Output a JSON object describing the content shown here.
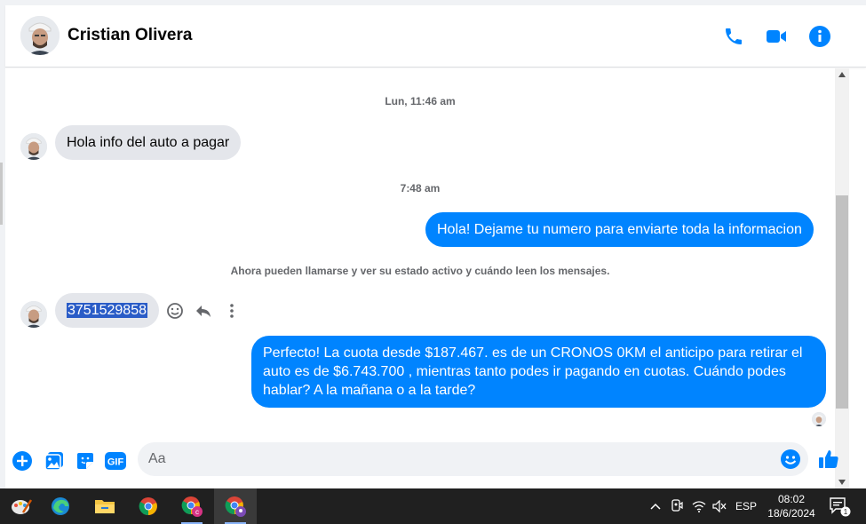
{
  "header": {
    "contact_name": "Cristian Olivera",
    "icons": [
      "phone-icon",
      "video-camera-icon",
      "info-icon"
    ]
  },
  "thread": {
    "timestamp_1": "Lun, 11:46 am",
    "message_1": "Hola info del auto a pagar",
    "timestamp_2": "7:48 am",
    "message_2": "Hola! Dejame tu numero para enviarte toda la informacion",
    "system_notice": "Ahora pueden llamarse y ver su estado activo y cuándo leen los mensajes.",
    "message_3": "3751529858",
    "message_4": "Perfecto! La cuota desde $187.467. es de un CRONOS 0KM el anticipo para retirar el auto es de $6.743.700 , mientras tanto podes ir pagando en cuotas. Cuándo podes hablar? A la mañana o a la tarde?"
  },
  "composer": {
    "placeholder": "Aa",
    "icons": [
      "plus-circle-icon",
      "photo-icon",
      "sticker-icon",
      "gif-icon",
      "emoji-icon",
      "thumbs-up-icon"
    ],
    "gif_label": "GIF"
  },
  "taskbar": {
    "language": "ESP",
    "time": "08:02",
    "date": "18/6/2024",
    "notification_count": "1"
  },
  "colors": {
    "accent": "#0084ff",
    "incoming_bubble": "#e4e6eb",
    "taskbar": "#202020"
  }
}
